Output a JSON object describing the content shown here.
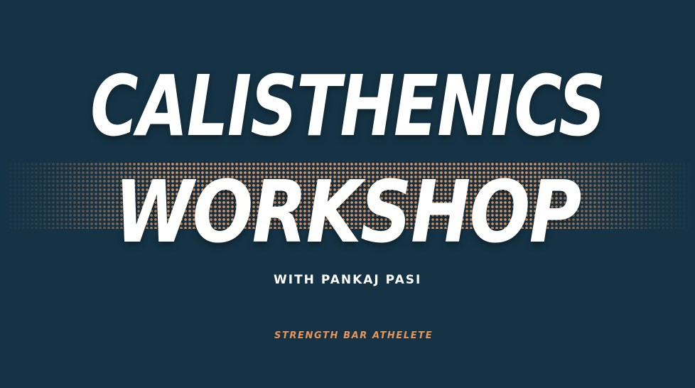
{
  "banner": {
    "title_line1": "CALISTHENICS",
    "title_line2": "WORKSHOP",
    "subtitle": "WITH PANKAJ PASI",
    "tagline": "STRENGTH BAR ATHELETE"
  },
  "colors": {
    "background": "#153345",
    "accent": "#e8955a",
    "title": "#ffffff"
  }
}
